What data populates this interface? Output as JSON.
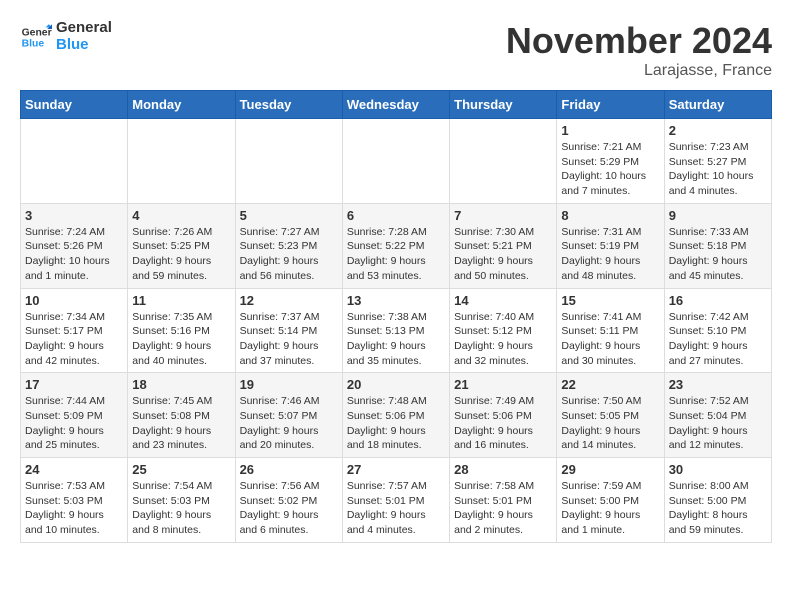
{
  "header": {
    "logo_line1": "General",
    "logo_line2": "Blue",
    "month": "November 2024",
    "location": "Larajasse, France"
  },
  "weekdays": [
    "Sunday",
    "Monday",
    "Tuesday",
    "Wednesday",
    "Thursday",
    "Friday",
    "Saturday"
  ],
  "weeks": [
    [
      {
        "day": "",
        "content": ""
      },
      {
        "day": "",
        "content": ""
      },
      {
        "day": "",
        "content": ""
      },
      {
        "day": "",
        "content": ""
      },
      {
        "day": "",
        "content": ""
      },
      {
        "day": "1",
        "content": "Sunrise: 7:21 AM\nSunset: 5:29 PM\nDaylight: 10 hours and 7 minutes."
      },
      {
        "day": "2",
        "content": "Sunrise: 7:23 AM\nSunset: 5:27 PM\nDaylight: 10 hours and 4 minutes."
      }
    ],
    [
      {
        "day": "3",
        "content": "Sunrise: 7:24 AM\nSunset: 5:26 PM\nDaylight: 10 hours and 1 minute."
      },
      {
        "day": "4",
        "content": "Sunrise: 7:26 AM\nSunset: 5:25 PM\nDaylight: 9 hours and 59 minutes."
      },
      {
        "day": "5",
        "content": "Sunrise: 7:27 AM\nSunset: 5:23 PM\nDaylight: 9 hours and 56 minutes."
      },
      {
        "day": "6",
        "content": "Sunrise: 7:28 AM\nSunset: 5:22 PM\nDaylight: 9 hours and 53 minutes."
      },
      {
        "day": "7",
        "content": "Sunrise: 7:30 AM\nSunset: 5:21 PM\nDaylight: 9 hours and 50 minutes."
      },
      {
        "day": "8",
        "content": "Sunrise: 7:31 AM\nSunset: 5:19 PM\nDaylight: 9 hours and 48 minutes."
      },
      {
        "day": "9",
        "content": "Sunrise: 7:33 AM\nSunset: 5:18 PM\nDaylight: 9 hours and 45 minutes."
      }
    ],
    [
      {
        "day": "10",
        "content": "Sunrise: 7:34 AM\nSunset: 5:17 PM\nDaylight: 9 hours and 42 minutes."
      },
      {
        "day": "11",
        "content": "Sunrise: 7:35 AM\nSunset: 5:16 PM\nDaylight: 9 hours and 40 minutes."
      },
      {
        "day": "12",
        "content": "Sunrise: 7:37 AM\nSunset: 5:14 PM\nDaylight: 9 hours and 37 minutes."
      },
      {
        "day": "13",
        "content": "Sunrise: 7:38 AM\nSunset: 5:13 PM\nDaylight: 9 hours and 35 minutes."
      },
      {
        "day": "14",
        "content": "Sunrise: 7:40 AM\nSunset: 5:12 PM\nDaylight: 9 hours and 32 minutes."
      },
      {
        "day": "15",
        "content": "Sunrise: 7:41 AM\nSunset: 5:11 PM\nDaylight: 9 hours and 30 minutes."
      },
      {
        "day": "16",
        "content": "Sunrise: 7:42 AM\nSunset: 5:10 PM\nDaylight: 9 hours and 27 minutes."
      }
    ],
    [
      {
        "day": "17",
        "content": "Sunrise: 7:44 AM\nSunset: 5:09 PM\nDaylight: 9 hours and 25 minutes."
      },
      {
        "day": "18",
        "content": "Sunrise: 7:45 AM\nSunset: 5:08 PM\nDaylight: 9 hours and 23 minutes."
      },
      {
        "day": "19",
        "content": "Sunrise: 7:46 AM\nSunset: 5:07 PM\nDaylight: 9 hours and 20 minutes."
      },
      {
        "day": "20",
        "content": "Sunrise: 7:48 AM\nSunset: 5:06 PM\nDaylight: 9 hours and 18 minutes."
      },
      {
        "day": "21",
        "content": "Sunrise: 7:49 AM\nSunset: 5:06 PM\nDaylight: 9 hours and 16 minutes."
      },
      {
        "day": "22",
        "content": "Sunrise: 7:50 AM\nSunset: 5:05 PM\nDaylight: 9 hours and 14 minutes."
      },
      {
        "day": "23",
        "content": "Sunrise: 7:52 AM\nSunset: 5:04 PM\nDaylight: 9 hours and 12 minutes."
      }
    ],
    [
      {
        "day": "24",
        "content": "Sunrise: 7:53 AM\nSunset: 5:03 PM\nDaylight: 9 hours and 10 minutes."
      },
      {
        "day": "25",
        "content": "Sunrise: 7:54 AM\nSunset: 5:03 PM\nDaylight: 9 hours and 8 minutes."
      },
      {
        "day": "26",
        "content": "Sunrise: 7:56 AM\nSunset: 5:02 PM\nDaylight: 9 hours and 6 minutes."
      },
      {
        "day": "27",
        "content": "Sunrise: 7:57 AM\nSunset: 5:01 PM\nDaylight: 9 hours and 4 minutes."
      },
      {
        "day": "28",
        "content": "Sunrise: 7:58 AM\nSunset: 5:01 PM\nDaylight: 9 hours and 2 minutes."
      },
      {
        "day": "29",
        "content": "Sunrise: 7:59 AM\nSunset: 5:00 PM\nDaylight: 9 hours and 1 minute."
      },
      {
        "day": "30",
        "content": "Sunrise: 8:00 AM\nSunset: 5:00 PM\nDaylight: 8 hours and 59 minutes."
      }
    ]
  ]
}
